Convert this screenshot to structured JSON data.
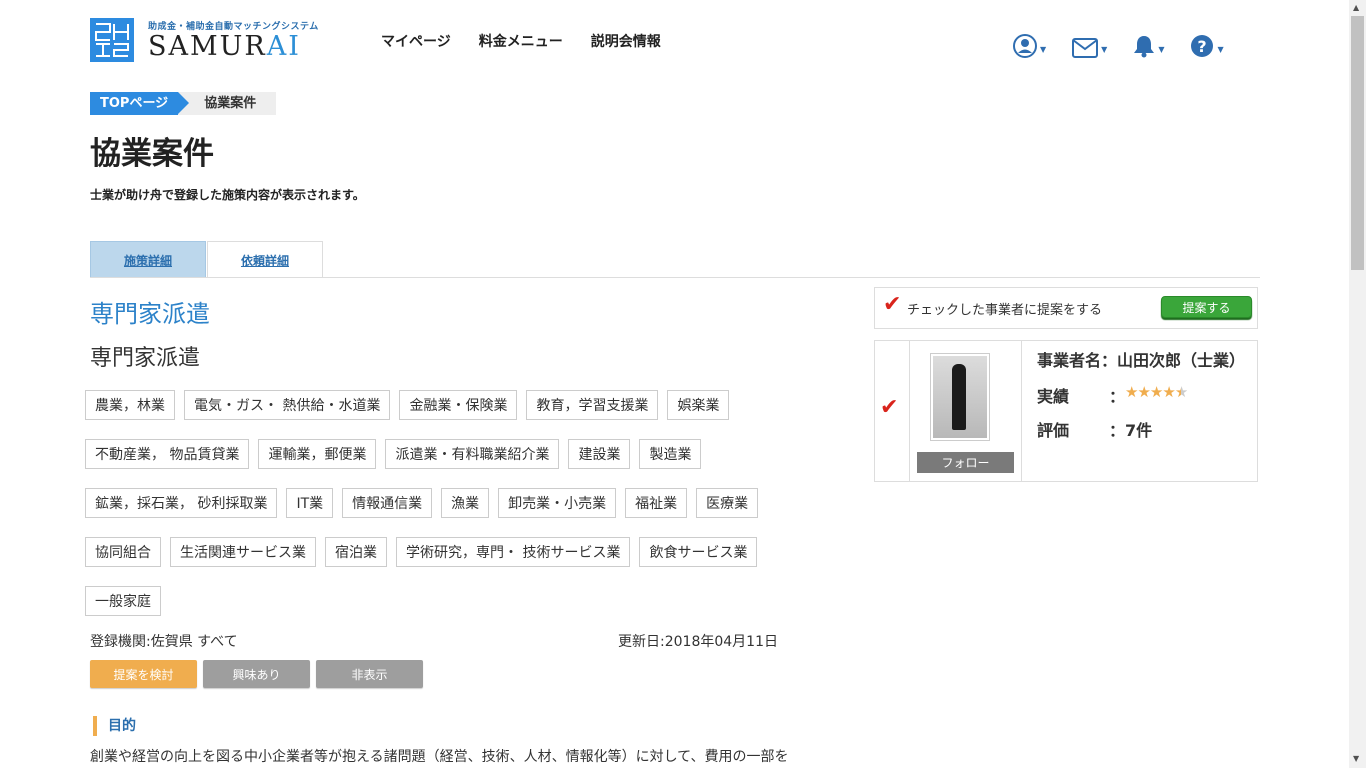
{
  "header": {
    "logo_sub": "助成金・補助金自動マッチングシステム",
    "logo_main": "SAMURAI",
    "nav": [
      "マイページ",
      "料金メニュー",
      "説明会情報"
    ],
    "icons": [
      "user-icon",
      "mail-icon",
      "bell-icon",
      "help-icon"
    ]
  },
  "breadcrumb": {
    "top": "TOPページ",
    "current": "協業案件"
  },
  "page": {
    "title": "協業案件",
    "description": "士業が助け舟で登録した施策内容が表示されます。"
  },
  "tabs": [
    {
      "label": "施策詳細",
      "active": true
    },
    {
      "label": "依頼詳細",
      "active": false
    }
  ],
  "content": {
    "title_link": "専門家派遣",
    "title_plain": "専門家派遣",
    "tags": [
      "農業，林業",
      "電気・ガス・ 熱供給・水道業",
      "金融業・保険業",
      "教育，学習支援業",
      "娯楽業",
      "不動産業， 物品賃貸業",
      "運輸業，郵便業",
      "派遣業・有料職業紹介業",
      "建設業",
      "製造業",
      "鉱業，採石業， 砂利採取業",
      "IT業",
      "情報通信業",
      "漁業",
      "卸売業・小売業",
      "福祉業",
      "医療業",
      "協同組合",
      "生活関連サービス業",
      "宿泊業",
      "学術研究，専門・ 技術サービス業",
      "飲食サービス業",
      "一般家庭"
    ],
    "org": "登録機関:佐賀県 すべて",
    "updated": "更新日:2018年04月11日",
    "buttons": {
      "consider": "提案を検討",
      "interest": "興味あり",
      "hide": "非表示"
    },
    "section_title": "目的",
    "section_body": "創業や経営の向上を図る中小企業者等が抱える諸問題（経営、技術、人材、情報化等）に対して、費用の一部を"
  },
  "sidebar": {
    "check_label": "チェックした事業者に提案をする",
    "propose_button": "提案する",
    "card": {
      "name": "事業者名：山田次郎（士業）",
      "follow": "フォロー",
      "results_label": "実績",
      "rating": 4.5,
      "evaluation_label": "評価",
      "evaluation_value": "：7件"
    }
  },
  "colors": {
    "primary": "#2d8be0",
    "accent_orange": "#f0ad4e",
    "green": "#3aa63a",
    "check_red": "#d9241c"
  }
}
